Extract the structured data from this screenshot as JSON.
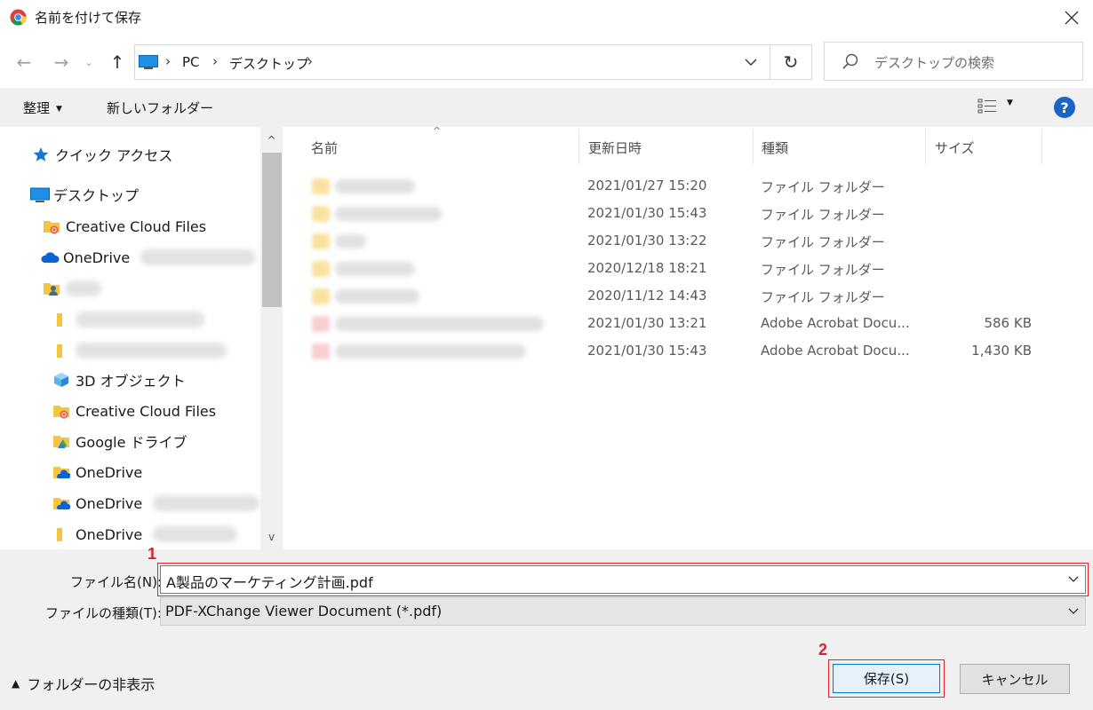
{
  "window": {
    "title": "名前を付けて保存"
  },
  "address": {
    "crumbs": [
      "PC",
      "デスクトップ"
    ],
    "search_placeholder": "デスクトップの検索"
  },
  "toolbar": {
    "organize": "整理",
    "new_folder": "新しいフォルダー"
  },
  "nav": {
    "quick_access": "クイック アクセス",
    "desktop": "デスクトップ",
    "creative_cloud_1": "Creative Cloud Files",
    "onedrive_1": "OneDrive",
    "objects_3d": "3D オブジェクト",
    "creative_cloud_2": "Creative Cloud Files",
    "google_drive": "Google ドライブ",
    "onedrive_2": "OneDrive",
    "onedrive_3": "OneDrive",
    "onedrive_4": "OneDrive"
  },
  "columns": {
    "name": "名前",
    "modified": "更新日時",
    "type": "種類",
    "size": "サイズ"
  },
  "files": [
    {
      "modified": "2021/01/27 15:20",
      "type": "ファイル フォルダー",
      "size": "",
      "kind": "folder"
    },
    {
      "modified": "2021/01/30 15:43",
      "type": "ファイル フォルダー",
      "size": "",
      "kind": "folder"
    },
    {
      "modified": "2021/01/30 13:22",
      "type": "ファイル フォルダー",
      "size": "",
      "kind": "folder"
    },
    {
      "modified": "2020/12/18 18:21",
      "type": "ファイル フォルダー",
      "size": "",
      "kind": "folder"
    },
    {
      "modified": "2020/11/12 14:43",
      "type": "ファイル フォルダー",
      "size": "",
      "kind": "folder"
    },
    {
      "modified": "2021/01/30 13:21",
      "type": "Adobe Acrobat Docu...",
      "size": "586 KB",
      "kind": "pdf"
    },
    {
      "modified": "2021/01/30 15:43",
      "type": "Adobe Acrobat Docu...",
      "size": "1,430 KB",
      "kind": "pdf"
    }
  ],
  "form": {
    "filename_label": "ファイル名(N):",
    "filename_value": "A製品のマーケティング計画.pdf",
    "filetype_label": "ファイルの種類(T):",
    "filetype_value": "PDF-XChange Viewer Document (*.pdf)"
  },
  "footer": {
    "hide_folders": "フォルダーの非表示",
    "save": "保存(S)",
    "cancel": "キャンセル"
  },
  "markers": {
    "one": "1",
    "two": "2"
  },
  "colors": {
    "highlight_red": "#e0242f",
    "accent_blue": "#0078d7",
    "folder_yellow": "#f5c542"
  }
}
